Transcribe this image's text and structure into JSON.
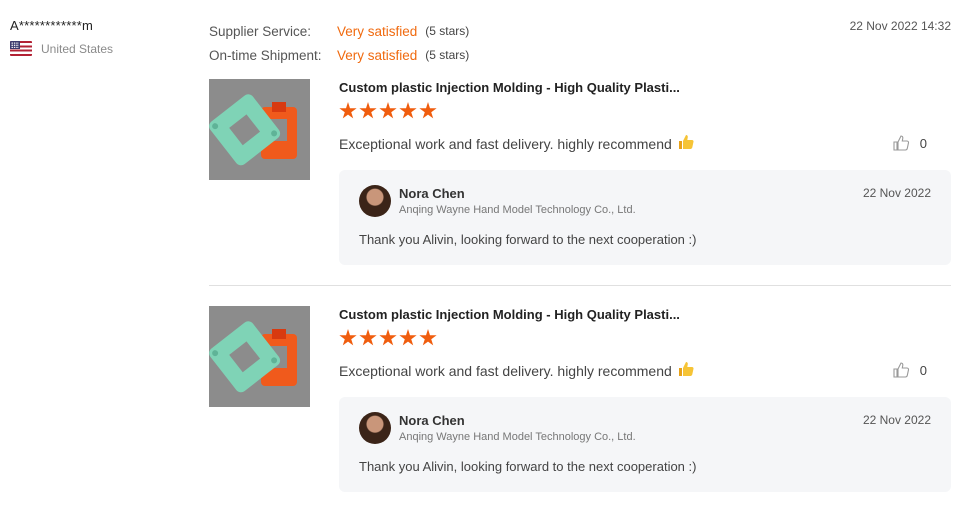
{
  "reviewer": {
    "name": "A************m",
    "country": "United States",
    "flag_icon": "us-flag-icon"
  },
  "ratings": [
    {
      "label": "Supplier Service:",
      "value": "Very satisfied",
      "stars": "(5 stars)"
    },
    {
      "label": "On-time Shipment:",
      "value": "Very satisfied",
      "stars": "(5 stars)"
    }
  ],
  "review_date": "22 Nov 2022 14:32",
  "entries": [
    {
      "product_title": "Custom plastic Injection Molding - High Quality Plasti...",
      "rating": 5,
      "comment": "Exceptional work and fast delivery. highly recommend",
      "comment_emoji": "thumbs-up-emoji",
      "likes": "0",
      "reply": {
        "name": "Nora Chen",
        "company": "Anqing Wayne Hand Model Technology Co., Ltd.",
        "date": "22 Nov 2022",
        "text": "Thank you Alivin, looking forward to the next cooperation :)"
      }
    },
    {
      "product_title": "Custom plastic Injection Molding - High Quality Plasti...",
      "rating": 5,
      "comment": "Exceptional work and fast delivery. highly recommend",
      "comment_emoji": "thumbs-up-emoji",
      "likes": "0",
      "reply": {
        "name": "Nora Chen",
        "company": "Anqing Wayne Hand Model Technology Co., Ltd.",
        "date": "22 Nov 2022",
        "text": "Thank you Alivin, looking forward to the next cooperation :)"
      }
    }
  ],
  "colors": {
    "accent": "#f06a0f",
    "star": "#f05d0e",
    "reply_bg": "#f5f6f8"
  }
}
